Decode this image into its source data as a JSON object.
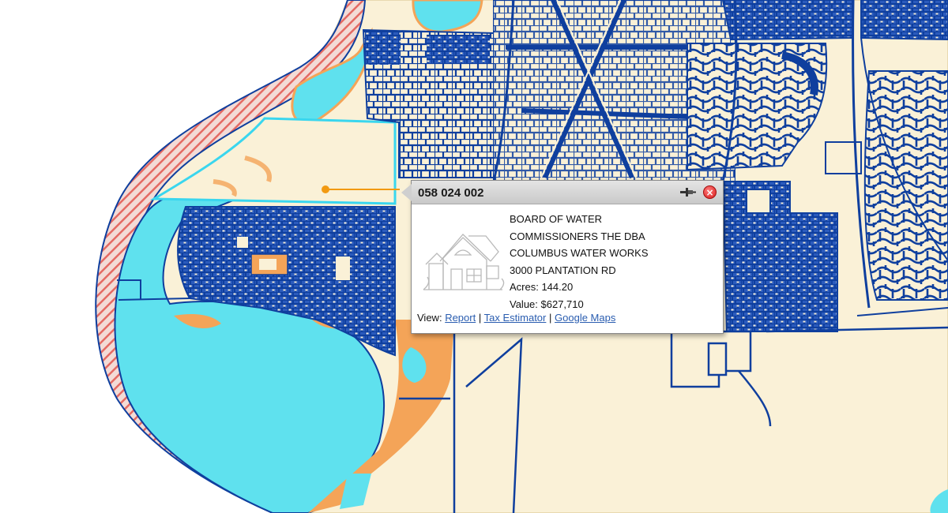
{
  "map": {
    "colors": {
      "land": "#faf1d7",
      "water": "#5fe1ee",
      "wetland": "#f4a458",
      "parcel_line": "#0f3f9e",
      "hatch": "#e46a63",
      "selected_outline": "#3ad6ee",
      "measure_marker": "#f29a12"
    }
  },
  "popup": {
    "parcel_id": "058 024 002",
    "owner_line1": "BOARD OF WATER",
    "owner_line2": "COMMISSIONERS THE DBA",
    "owner_line3": "COLUMBUS WATER WORKS",
    "address": "3000 PLANTATION RD",
    "acres": "Acres: 144.20",
    "value": "Value: $627,710",
    "view_label": "View:",
    "sep": "|",
    "links": {
      "report": "Report",
      "tax_estimator": "Tax Estimator",
      "google_maps": "Google Maps"
    },
    "icons": {
      "pin": "pin-icon",
      "close": "close-icon",
      "house": "house-icon"
    }
  }
}
